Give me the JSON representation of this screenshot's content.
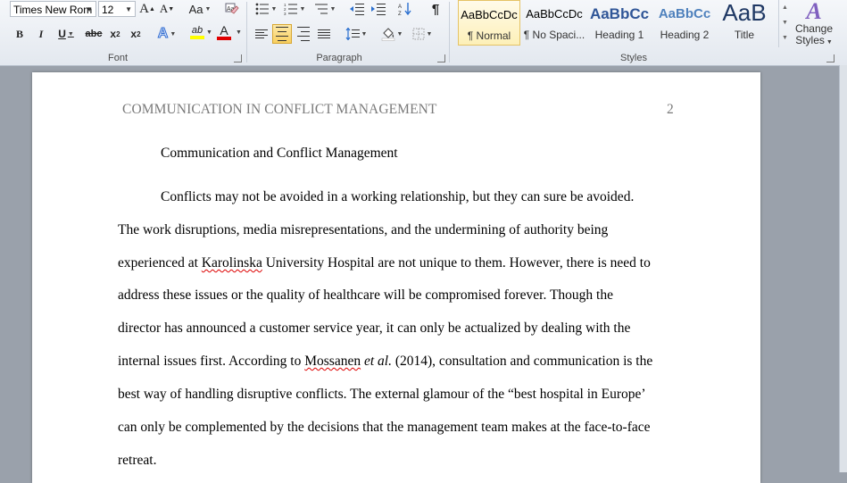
{
  "ribbon": {
    "font": {
      "group_label": "Font",
      "font_name": "Times New Rom",
      "font_size": "12",
      "grow_label": "A",
      "shrink_label": "A",
      "case_label": "Aa",
      "bold": "B",
      "italic": "I",
      "underline": "U",
      "strike": "abc",
      "subscript": "x",
      "superscript": "x",
      "sub_mark": "2",
      "sup_mark": "2",
      "highlight_label": "ab",
      "font_color_label": "A",
      "text_effects_label": "A"
    },
    "paragraph": {
      "group_label": "Paragraph",
      "show_marks": "¶"
    },
    "styles": {
      "group_label": "Styles",
      "items": [
        {
          "sample": "AaBbCcDc",
          "name": "¶ Normal",
          "selected": true
        },
        {
          "sample": "AaBbCcDc",
          "name": "¶ No Spaci..."
        },
        {
          "sample": "AaBbCc",
          "name": "Heading 1"
        },
        {
          "sample": "AaBbCc",
          "name": "Heading 2"
        },
        {
          "sample": "AaB",
          "name": "Title"
        }
      ],
      "change_styles_line1": "Change",
      "change_styles_line2": "Styles"
    },
    "colors": {
      "highlight": "#ffff00",
      "font_color": "#e00000",
      "heading_blue": "#2f5597"
    }
  },
  "document": {
    "header": "COMMUNICATION IN CONFLICT MANAGEMENT",
    "page_number": "2",
    "title": "Communication and Conflict Management",
    "lines": {
      "l1": "Conflicts may not be avoided in a working relationship, but they can sure be avoided.",
      "l2": "The work disruptions, media misrepresentations, and the undermining of authority being",
      "l3_a": "experienced at ",
      "l3_b": "Karolinska",
      "l3_c": " University Hospital are not unique to them. However, there is need to",
      "l4": "address these issues or the quality of healthcare will be compromised forever. Though the",
      "l5": "director has announced a customer service year, it can only be actualized by dealing with the",
      "l6_a": "internal issues first. According to ",
      "l6_b": "Mossanen",
      "l6_c": " ",
      "l6_d": "et al.",
      "l6_e": " (2014), consultation and communication is the",
      "l7": "best way of handling disruptive conflicts. The external glamour of the “best hospital in Europe’",
      "l8": "can only be complemented by the decisions that the management team makes at the face-to-face",
      "l9": "retreat."
    }
  }
}
